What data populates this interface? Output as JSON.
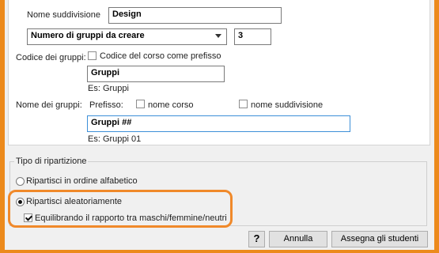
{
  "form": {
    "subdivision_name_label": "Nome suddivisione",
    "subdivision_name_value": "Design",
    "mode_select_value": "Numero di gruppi da creare",
    "group_count_value": "3",
    "group_code_label": "Codice dei gruppi:",
    "course_code_prefix_label": "Codice del corso come prefisso",
    "group_code_value": "Gruppi",
    "group_code_example": "Es: Gruppi",
    "group_names_label": "Nome dei gruppi:",
    "prefix_label": "Prefisso:",
    "course_name_label": "nome corso",
    "subdivision_name_option_label": "nome suddivisione",
    "group_names_value": "Gruppi ##",
    "group_names_example": "Es: Gruppi 01"
  },
  "distribution": {
    "title": "Tipo di ripartizione",
    "alphabetical_label": "Ripartisci in ordine alfabetico",
    "random_label": "Ripartisci aleatoriamente",
    "balance_label": "Equilibrando il rapporto tra maschi/femmine/neutri",
    "selected": "random",
    "balance_checked": true
  },
  "buttons": {
    "help_label": "?",
    "cancel_label": "Annulla",
    "assign_label": "Assegna gli studenti"
  },
  "colors": {
    "highlight": "#f0892a",
    "focus_border": "#3c8fd8"
  }
}
